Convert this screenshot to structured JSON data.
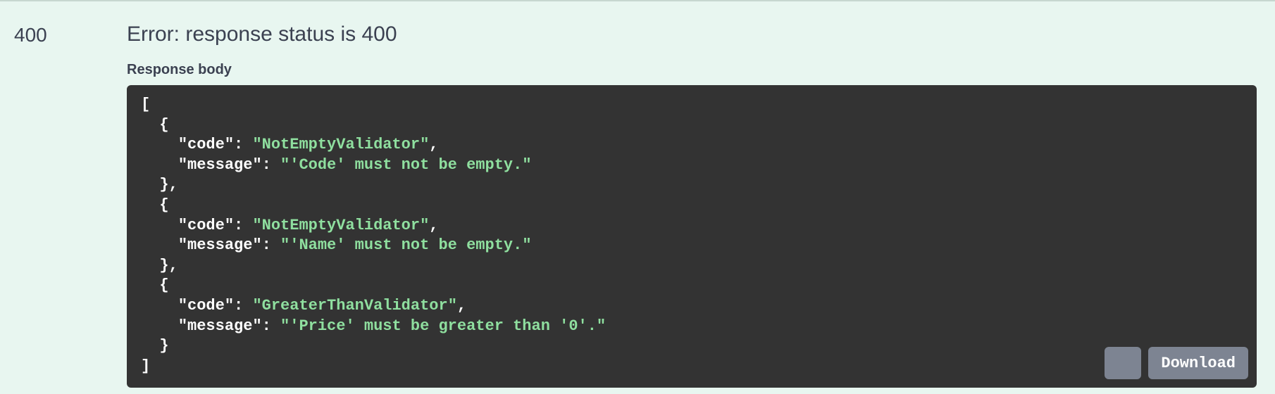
{
  "status_code": "400",
  "error_line": "Error: response status is 400",
  "body_label": "Response body",
  "download_label": "Download",
  "response": [
    {
      "code": "NotEmptyValidator",
      "message": "'Code' must not be empty."
    },
    {
      "code": "NotEmptyValidator",
      "message": "'Name' must not be empty."
    },
    {
      "code": "GreaterThanValidator",
      "message": "'Price' must be greater than '0'."
    }
  ],
  "keys": {
    "code": "code",
    "message": "message"
  }
}
